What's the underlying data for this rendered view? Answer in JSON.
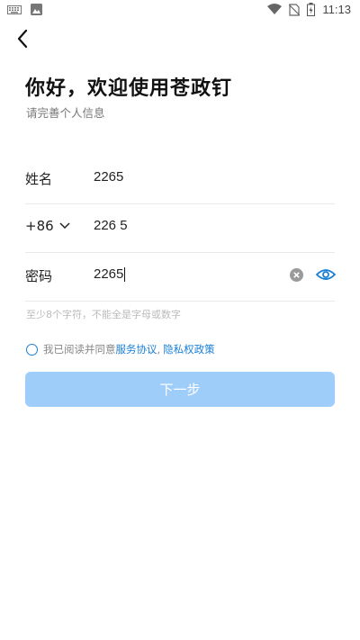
{
  "status_bar": {
    "time": "11:13",
    "icons": [
      "keyboard-icon",
      "image-icon",
      "wifi-icon",
      "no-sim-icon",
      "battery-charging-icon"
    ]
  },
  "header": {
    "title": "你好，欢迎使用苍政钉",
    "subtitle": "请完善个人信息"
  },
  "form": {
    "name_label": "姓名",
    "name_value": "2265",
    "country_code": "+86",
    "phone_value": "226 5",
    "password_label": "密码",
    "password_value": "2265",
    "password_hint": "至少8个字符，不能全是字母或数字"
  },
  "agreement": {
    "prefix": "我已阅读并同意",
    "service_link": "服务协议",
    "separator": ",",
    "privacy_link": "隐私权政策"
  },
  "next_button": {
    "label": "下一步"
  },
  "colors": {
    "accent": "#1a7fd6",
    "button_disabled": "#9fcdf9"
  }
}
